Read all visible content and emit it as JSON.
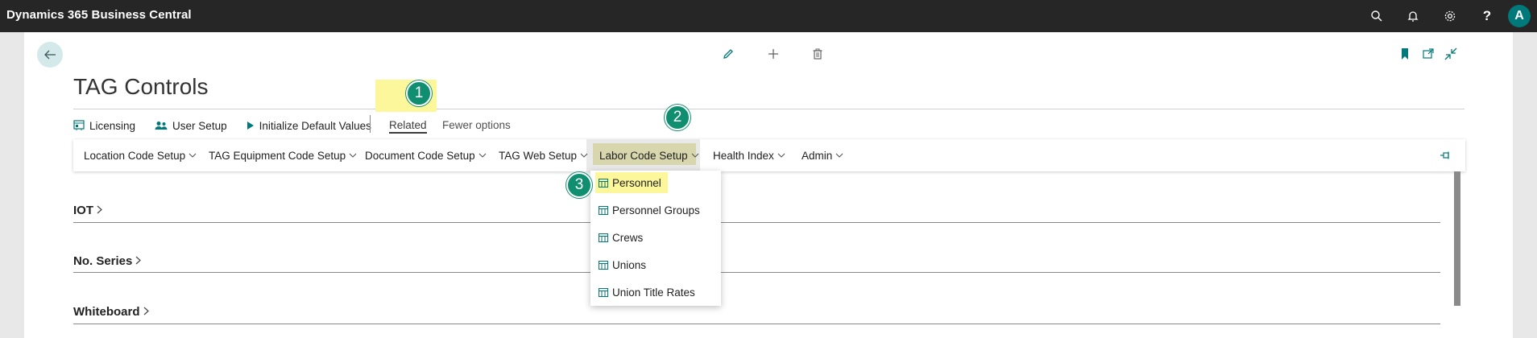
{
  "app": {
    "title": "Dynamics 365 Business Central",
    "user_initial": "A"
  },
  "topbar_icons": [
    "search-icon",
    "bell-icon",
    "gear-icon",
    "help-icon"
  ],
  "topbar_help_glyph": "?",
  "page": {
    "title": "TAG Controls"
  },
  "header_actions": [
    "edit-icon",
    "new-icon",
    "delete-icon"
  ],
  "header_right_icons": [
    "bookmark-icon",
    "open-new-window-icon",
    "collapse-icon"
  ],
  "actions": {
    "licensing": "Licensing",
    "user_setup": "User Setup",
    "initialize": "Initialize Default Values",
    "related": "Related",
    "fewer": "Fewer options"
  },
  "menu": {
    "location": "Location Code Setup",
    "equipment": "TAG Equipment Code Setup",
    "document": "Document Code Setup",
    "web": "TAG Web Setup",
    "labor": "Labor Code Setup",
    "health": "Health Index",
    "admin": "Admin"
  },
  "dropdown": {
    "personnel": "Personnel",
    "personnel_groups": "Personnel Groups",
    "crews": "Crews",
    "unions": "Unions",
    "union_title_rates": "Union Title Rates"
  },
  "sections": {
    "iot": "IOT",
    "no_series": "No. Series",
    "whiteboard": "Whiteboard"
  },
  "badges": {
    "one": "1",
    "two": "2",
    "three": "3"
  },
  "colors": {
    "accent": "#00797a",
    "highlight": "#fbf79a",
    "badge": "#0f8f6f"
  }
}
